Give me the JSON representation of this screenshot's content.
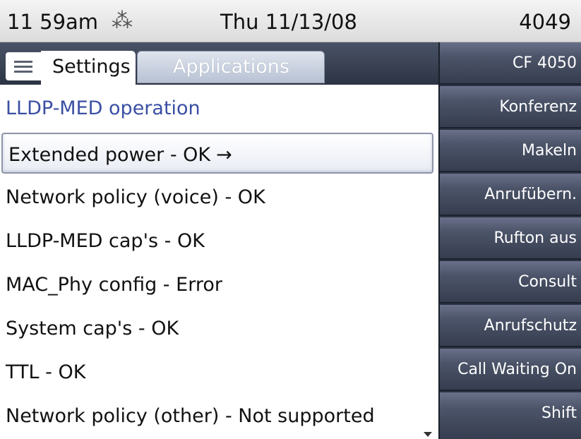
{
  "status": {
    "time": "11 59am",
    "bluetooth_icon": "bluetooth-icon",
    "date": "Thu 11/13/08",
    "extension": "4049"
  },
  "tabs": {
    "settings": "Settings",
    "applications": "Applications"
  },
  "list": {
    "heading": "LLDP-MED operation",
    "items": [
      {
        "label": "Extended power - OK",
        "arrow": "→",
        "selected": true
      },
      {
        "label": "Network policy (voice) - OK"
      },
      {
        "label": "LLDP-MED cap's - OK"
      },
      {
        "label": "MAC_Phy config - Error"
      },
      {
        "label": "System cap's - OK"
      },
      {
        "label": "TTL - OK"
      },
      {
        "label": "Network policy (other) - Not supported"
      }
    ]
  },
  "softkeys": [
    "CF 4050",
    "Konferenz",
    "Makeln",
    "Anrufübern.",
    "Rufton aus",
    "Consult",
    "Anrufschutz",
    "Call Waiting On",
    "Shift"
  ],
  "colors": {
    "heading": "#3a4fa3",
    "softkey_bg": "#4c5469"
  }
}
